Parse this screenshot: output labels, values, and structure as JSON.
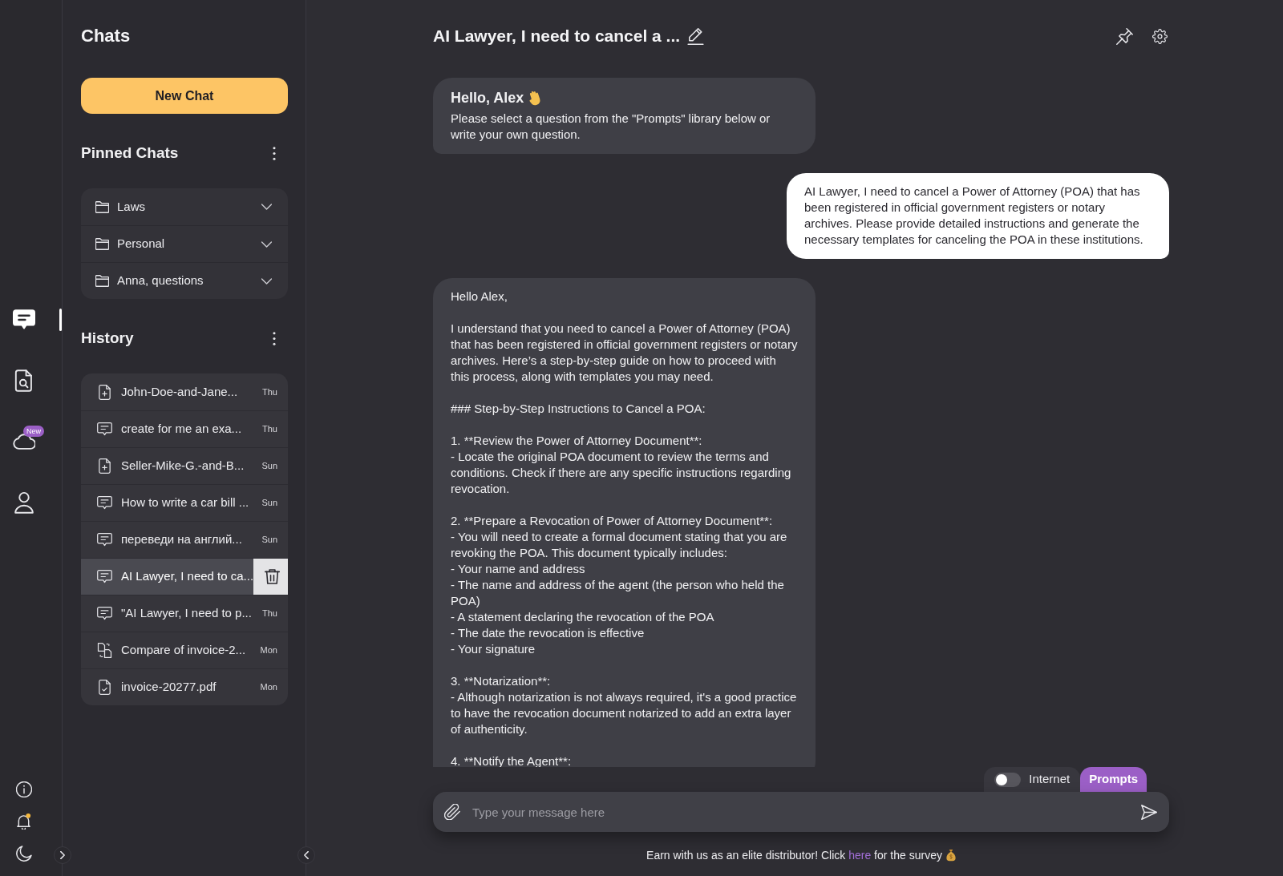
{
  "rail": {
    "items": [
      {
        "kind": "chats",
        "selected": true
      },
      {
        "kind": "documents",
        "selected": false
      },
      {
        "kind": "cloud",
        "selected": false,
        "badge": "New"
      },
      {
        "kind": "profile",
        "selected": false
      }
    ],
    "notifications": {
      "unread": true
    }
  },
  "sidebar": {
    "title": "Chats",
    "new_chat_button": "New Chat",
    "pinned": {
      "heading": "Pinned Chats",
      "folders": [
        {
          "name": "Laws",
          "expanded": false
        },
        {
          "name": "Personal",
          "expanded": false
        },
        {
          "name": "Anna, questions",
          "expanded": false
        }
      ]
    },
    "history": {
      "heading": "History",
      "items": [
        {
          "kind": "document",
          "title": "John-Doe-and-Jane...",
          "day": "Thu",
          "selected": false
        },
        {
          "kind": "chat",
          "title": "create for me an exa...",
          "day": "Thu",
          "selected": false
        },
        {
          "kind": "document",
          "title": "Seller-Mike-G.-and-B...",
          "day": "Sun",
          "selected": false
        },
        {
          "kind": "chat",
          "title": "How to write a car bill ...",
          "day": "Sun",
          "selected": false
        },
        {
          "kind": "chat",
          "title": "переведи на англий...",
          "day": "Sun",
          "selected": false
        },
        {
          "kind": "chat",
          "title": "AI Lawyer, I need to ca...",
          "selected": true
        },
        {
          "kind": "chat",
          "title": "\"AI Lawyer, I need to p...",
          "day": "Thu",
          "selected": false
        },
        {
          "kind": "comparison",
          "title": "Compare of invoice-2...",
          "day": "Mon",
          "selected": false
        },
        {
          "kind": "pdf",
          "title": "invoice-20277.pdf",
          "day": "Mon",
          "selected": false
        }
      ]
    }
  },
  "chat": {
    "title": "AI Lawyer, I need to cancel a ...",
    "messages": [
      {
        "kind": "assistant",
        "heading": "Hello, Alex",
        "text": "Please select a question from the \"Prompts\" library below or write your own question."
      },
      {
        "kind": "user",
        "text": "AI Lawyer, I need to cancel a Power of Attorney (POA) that has been registered in official government registers or notary archives. Please provide detailed instructions and generate the necessary templates for canceling the POA in these institutions."
      },
      {
        "kind": "assistant",
        "paragraphs": [
          "Hello Alex,",
          "I understand that you need to cancel a Power of Attorney (POA) that has been registered in official government registers or notary archives. Here’s a step-by-step guide on how to proceed with this process, along with templates you may need.",
          "### Step-by-Step Instructions to Cancel a POA:",
          "1. **Review the Power of Attorney Document**:\n- Locate the original POA document to review the terms and conditions. Check if there are any specific instructions regarding revocation.",
          "2. **Prepare a Revocation of Power of Attorney Document**:\n- You will need to create a formal document stating that you are revoking the POA. This document typically includes:\n- Your name and address\n- The name and address of the agent (the person who held the POA)\n- A statement declaring the revocation of the POA\n- The date the revocation is effective\n- Your signature",
          "3. **Notarization**:\n- Although notarization is not always required, it's a good practice to have the revocation document notarized to add an extra layer of authenticity.",
          "4. **Notify the Agent**:"
        ]
      }
    ],
    "internet_toggle": {
      "label": "Internet",
      "on": false
    },
    "prompts_button": "Prompts",
    "input": {
      "placeholder": "Type your message here"
    },
    "footer": {
      "text": "Earn with us as an elite distributor! Click",
      "link": "here",
      "text_after": "for the survey"
    }
  }
}
